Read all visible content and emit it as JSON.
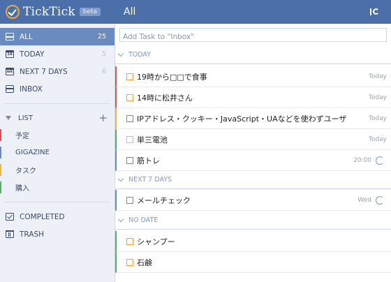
{
  "app": {
    "brand": "TickTick",
    "beta": "beta",
    "header_title": "All",
    "header_icon": "sort-icon"
  },
  "colors": {
    "header": "#4b6fa8",
    "sidebar_bg": "#edf1f7",
    "active": "#6a8bc0",
    "accent_orange": "#f2a43a"
  },
  "sidebar": {
    "nav": [
      {
        "label": "ALL",
        "count": "25",
        "icon": "all-tasks-icon"
      },
      {
        "label": "TODAY",
        "count": "5",
        "icon": "calendar-today-icon",
        "icon_text": "18"
      },
      {
        "label": "NEXT 7 DAYS",
        "count": "6",
        "icon": "calendar-week-icon",
        "icon_text": "wk"
      },
      {
        "label": "INBOX",
        "count": "",
        "icon": "inbox-icon"
      }
    ],
    "list_header": "LIST",
    "lists": [
      {
        "label": "予定",
        "color": "#d9534f"
      },
      {
        "label": "GIGAZINE",
        "color": "#6a8bc0"
      },
      {
        "label": "タスク",
        "color": "#e8b84a"
      },
      {
        "label": "購入",
        "color": "#5aad6a"
      }
    ],
    "footer": [
      {
        "label": "COMPLETED",
        "icon": "completed-check-icon"
      },
      {
        "label": "TRASH",
        "icon": "trash-icon"
      }
    ]
  },
  "main": {
    "add_placeholder": "Add Task to \"Inbox\"",
    "sections": [
      {
        "title": "TODAY",
        "tasks": [
          {
            "title": "19時から□□で食事",
            "date": "Today",
            "repeat": false,
            "color": "#d9534f",
            "checkbox": "#f2a43a"
          },
          {
            "title": "14時に松井さん",
            "date": "Today",
            "repeat": false,
            "color": "#d9534f",
            "checkbox": "#f2a43a"
          },
          {
            "title": "IPアドレス・クッキー・JavaScript・UAなどを使わずユーザ",
            "date": "Today",
            "repeat": false,
            "color": "#e8b84a",
            "checkbox": "#7b8aa3"
          },
          {
            "title": "単三電池",
            "date": "Today",
            "repeat": false,
            "color": "#5aad6a",
            "checkbox": "#b8c0cc"
          },
          {
            "title": "筋トレ",
            "date": "20:00",
            "repeat": true,
            "color": "#6a8bc0",
            "checkbox": "#7b8aa3"
          }
        ]
      },
      {
        "title": "NEXT 7 DAYS",
        "tasks": [
          {
            "title": "メールチェック",
            "date": "Wed",
            "repeat": true,
            "color": "#6a8bc0",
            "checkbox": "#7b8aa3"
          }
        ]
      },
      {
        "title": "NO DATE",
        "tasks": [
          {
            "title": "シャンプー",
            "date": "",
            "repeat": false,
            "color": "#5aad6a",
            "checkbox": "#f2a43a"
          },
          {
            "title": "石鹸",
            "date": "",
            "repeat": false,
            "color": "#5aad6a",
            "checkbox": "#f2a43a"
          }
        ]
      }
    ]
  }
}
